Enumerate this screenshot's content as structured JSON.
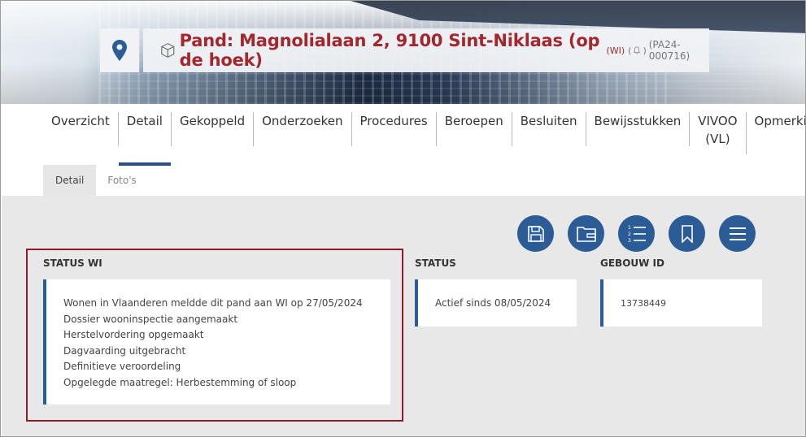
{
  "header": {
    "title": "Pand: Magnolialaan 2, 9100 Sint-Niklaas (op de hoek)",
    "sub_tag": "(WI)",
    "paren_open": "(",
    "paren_close": ")",
    "dossier_id": "(PA24-000716)"
  },
  "nav": {
    "tabs": [
      {
        "label": "Overzicht"
      },
      {
        "label": "Detail"
      },
      {
        "label": "Gekoppeld"
      },
      {
        "label": "Onderzoeken"
      },
      {
        "label": "Procedures"
      },
      {
        "label": "Beroepen"
      },
      {
        "label": "Besluiten"
      },
      {
        "label": "Bewijsstukken"
      },
      {
        "label_line1": "VIVOO",
        "label_line2": "(VL)"
      },
      {
        "label": "Opmerkingen"
      }
    ],
    "active": "Detail"
  },
  "subtabs": [
    {
      "label": "Detail"
    },
    {
      "label": "Foto's"
    }
  ],
  "status_wi": {
    "heading": "STATUS WI",
    "lines": [
      "Wonen in Vlaanderen meldde dit pand aan WI op 27/05/2024",
      "Dossier wooninspectie aangemaakt",
      "Herstelvordering opgemaakt",
      "Dagvaarding uitgebracht",
      "Definitieve veroordeling",
      "Opgelegde maatregel: Herbestemming of sloop"
    ]
  },
  "status": {
    "heading": "STATUS",
    "value": "Actief sinds 08/05/2024"
  },
  "gebouw": {
    "heading": "GEBOUW ID",
    "value": "13738449"
  },
  "actions": [
    "save-icon",
    "folder-icon",
    "numbered-list-icon",
    "bookmark-icon",
    "menu-icon"
  ],
  "colors": {
    "title_red": "#a3272d",
    "accent_blue": "#2c5c96",
    "highlight_border": "#8e1b2a"
  }
}
